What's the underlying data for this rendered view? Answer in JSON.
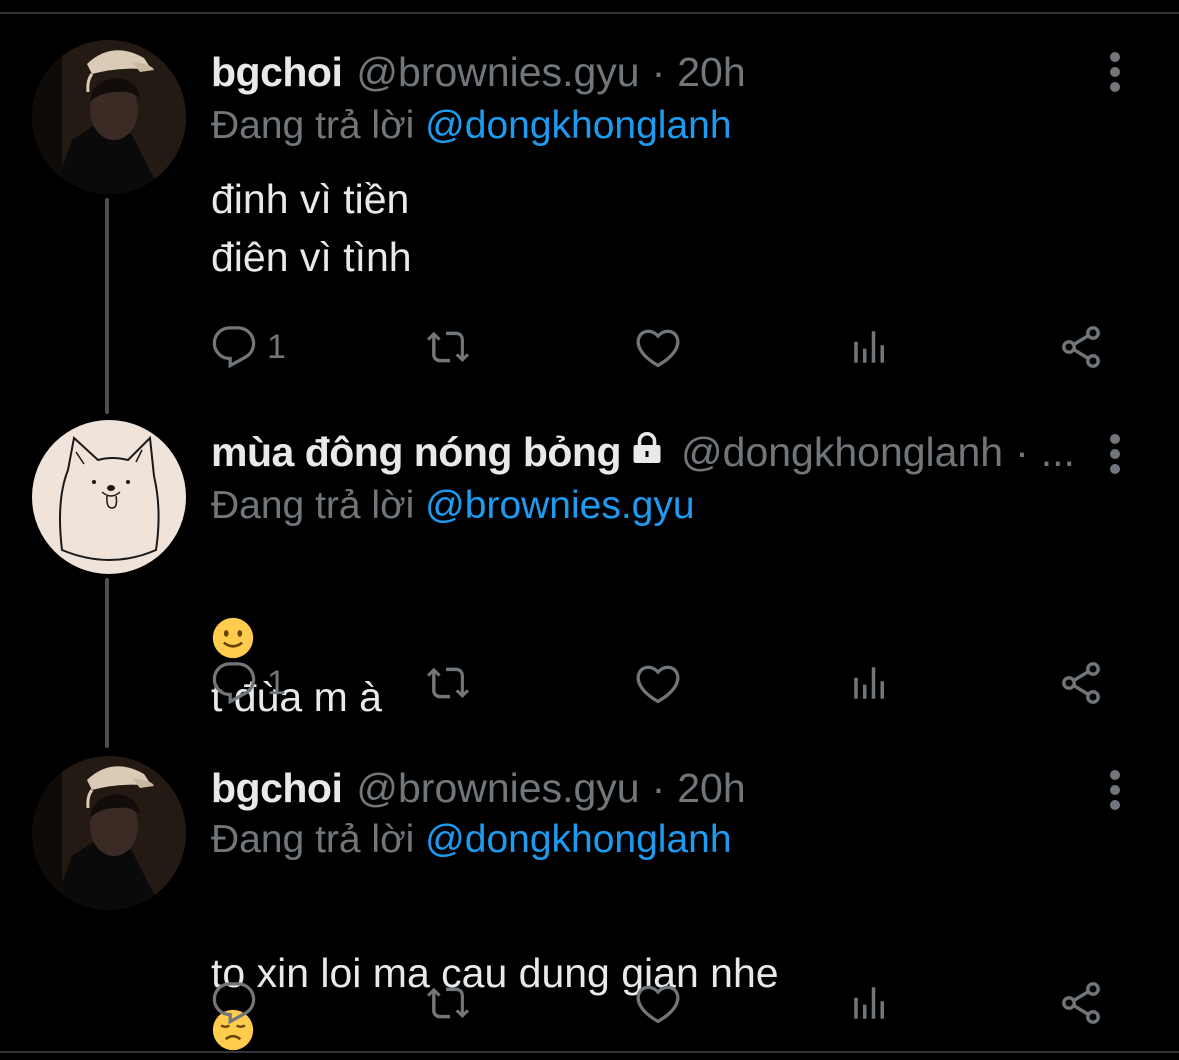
{
  "colors": {
    "background": "#000000",
    "text_primary": "#e7e9ea",
    "text_secondary": "#71767b",
    "link": "#1d9bf0",
    "thread_line": "#4a4f54"
  },
  "tweets": [
    {
      "display_name": "bgchoi",
      "handle": "@brownies.gyu",
      "separator": "·",
      "time": "20h",
      "locked": false,
      "replying_prefix": "Đang trả lời",
      "replying_to": "@dongkhonglanh",
      "text": "đinh vì tiền\nđiên vì tình",
      "reply_count": "1",
      "avatar": "user-photo-avatar"
    },
    {
      "display_name": "mùa đông nóng bỏng",
      "handle": "@dongkhonglanh",
      "separator": "·",
      "time": "...",
      "locked": true,
      "replying_prefix": "Đang trả lời",
      "replying_to": "@brownies.gyu",
      "emoji": "slightly-smiling-face",
      "text": "t đùa m à",
      "reply_count": "1",
      "avatar": "dog-drawing-avatar"
    },
    {
      "display_name": "bgchoi",
      "handle": "@brownies.gyu",
      "separator": "·",
      "time": "20h",
      "locked": false,
      "replying_prefix": "Đang trả lời",
      "replying_to": "@dongkhonglanh",
      "text": "to xin loi ma cau dung gian nhe",
      "emoji": "disappointed-face",
      "reply_count": "",
      "avatar": "user-photo-avatar"
    }
  ],
  "icons": {
    "reply": "reply-icon",
    "retweet": "retweet-icon",
    "like": "like-icon",
    "views": "views-icon",
    "share": "share-icon",
    "more": "more-vertical-icon",
    "lock": "lock-icon"
  }
}
